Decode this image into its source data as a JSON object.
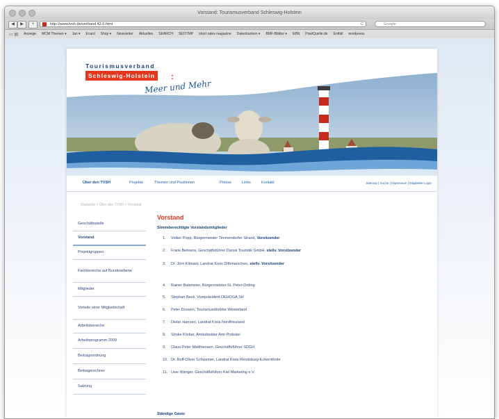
{
  "browser": {
    "window_title": "Vorstand: Tourismusverband Schleswig-Holstein",
    "back_label": "◀",
    "forward_label": "▶",
    "add_label": "+",
    "url": "http://www.tvsh.de/verband.42.0.html",
    "reload_label": "C",
    "search_placeholder": "Google",
    "bookmarks": [
      "Anzeige",
      "MCM Themen ▾",
      "Jan ▾",
      "Ecard",
      "Shop ▾",
      "Newsletter",
      "Aktuelles",
      "SEARCH",
      "SEOTMP",
      "short rates magazine",
      "Datenbanken ▾",
      "BMF-Blätter ▾",
      "EBN",
      "PixelQuelle.de",
      "Entfall",
      "wordpress"
    ]
  },
  "site": {
    "logo_line1": "Tourismusverband",
    "logo_line2": "Schleswig-Holstein",
    "logo_colon": ":",
    "logo_tagline": "Meer und Mehr",
    "nav": [
      "Über den TVSH",
      "Projekte",
      "Themen und Positionen",
      "Presse",
      "Links",
      "Kontakt"
    ],
    "util_links": "Sitemap | Suche | Impressum | Mitglieder-Login",
    "breadcrumb": "Startseite > Über den TVSH > Vorstand",
    "sidebar": [
      "Geschäftsstelle",
      "Vorstand",
      "Projektgruppen",
      "Fachbereiche auf Bundesebene",
      "Mitglieder",
      "Vorteile einer Mitgliedschaft",
      "Arbeitsbereiche",
      "Arbeitsprogramm 2009",
      "Beitragsordnung",
      "Beitragsrechner",
      "Satzung"
    ],
    "heading": "Vorstand",
    "voting_heading": "Stimmberechtigte Vorstandsmitglieder",
    "members": [
      {
        "num": "1.",
        "text": "Volker Popp, Bürgermeister Timmendorfer Strand,",
        "role": "Vorsitzender"
      },
      {
        "num": "2.",
        "text": "Frank Behrens, Geschäftsführer Dansk Touristik GmbH,",
        "role": "stellv. Vorsitzender"
      },
      {
        "num": "3.",
        "text": "Dr. Jörn Klimant, Landrat Kreis Dithmarschen,",
        "role": "stellv. Vorsitzender"
      },
      {
        "num": "4.",
        "text": "Rainer Balsmeier, Bürgermeister St. Peter-Ording",
        "role": ""
      },
      {
        "num": "5.",
        "text": "Stephan Beck, Vizepräsident DEHOGA SH",
        "role": ""
      },
      {
        "num": "6.",
        "text": "Peter Douven, Tourismusdirektor Westerland",
        "role": ""
      },
      {
        "num": "7.",
        "text": "Dieter Harrsen, Landrat Kreis Nordfriesland",
        "role": ""
      },
      {
        "num": "8.",
        "text": "Sönke Körber, Amtsdirektor Amt Probstei",
        "role": ""
      },
      {
        "num": "9.",
        "text": "Claus-Peter Matthiensen, Geschäftsführer SDGH",
        "role": ""
      },
      {
        "num": "10.",
        "text": "Dr. Rolf-Oliver Schwemer, Landrat Kreis Rendsburg-Eckernförde",
        "role": ""
      },
      {
        "num": "11.",
        "text": "Uwe Wanger, Geschäftsführer Kiel Marketing e.V.",
        "role": ""
      }
    ],
    "standing_heading": "Ständige Gäste"
  }
}
